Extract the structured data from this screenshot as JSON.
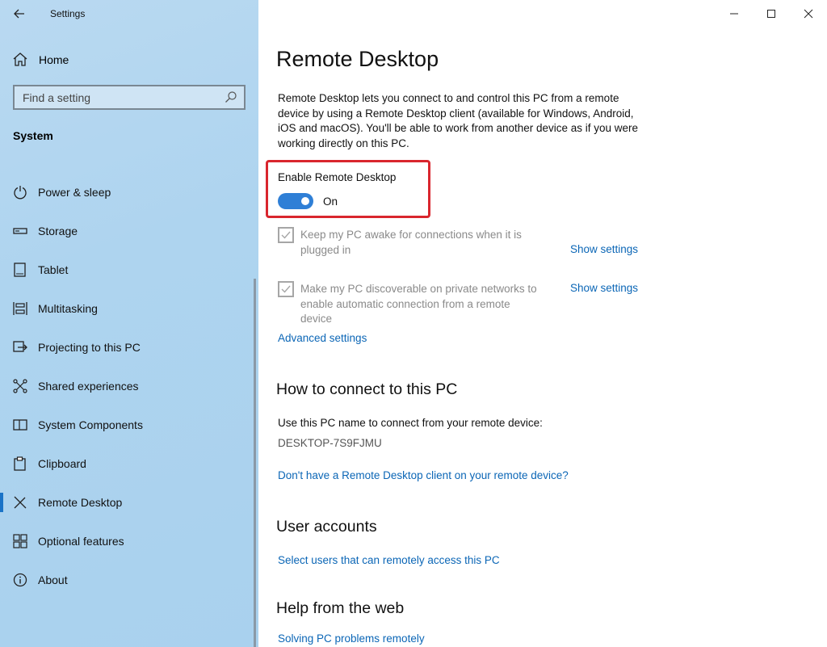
{
  "window": {
    "app_title": "Settings",
    "controls": [
      "minimize-icon",
      "maximize-icon",
      "close-icon"
    ]
  },
  "sidebar": {
    "home_label": "Home",
    "search_placeholder": "Find a setting",
    "section": "System",
    "items": [
      {
        "label": "Power & sleep",
        "icon": "power-icon"
      },
      {
        "label": "Storage",
        "icon": "storage-icon"
      },
      {
        "label": "Tablet",
        "icon": "tablet-icon"
      },
      {
        "label": "Multitasking",
        "icon": "multitasking-icon"
      },
      {
        "label": "Projecting to this PC",
        "icon": "projecting-icon"
      },
      {
        "label": "Shared experiences",
        "icon": "shared-experiences-icon"
      },
      {
        "label": "System Components",
        "icon": "system-components-icon"
      },
      {
        "label": "Clipboard",
        "icon": "clipboard-icon"
      },
      {
        "label": "Remote Desktop",
        "icon": "remote-desktop-icon",
        "active": true
      },
      {
        "label": "Optional features",
        "icon": "optional-features-icon"
      },
      {
        "label": "About",
        "icon": "info-icon"
      }
    ]
  },
  "main": {
    "title": "Remote Desktop",
    "description": "Remote Desktop lets you connect to and control this PC from a remote device by using a Remote Desktop client (available for Windows, Android, iOS and macOS). You'll be able to work from another device as if you were working directly on this PC.",
    "enable_label": "Enable Remote Desktop",
    "toggle_state": "On",
    "option1": "Keep my PC awake for connections when it is plugged in",
    "option2": "Make my PC discoverable on private networks to enable automatic connection from a remote device",
    "show_settings": "Show settings",
    "advanced_settings": "Advanced settings",
    "connect_heading": "How to connect to this PC",
    "connect_text": "Use this PC name to connect from your remote device:",
    "pc_name": "DESKTOP-7S9FJMU",
    "client_link": "Don't have a Remote Desktop client on your remote device?",
    "accounts_heading": "User accounts",
    "accounts_link": "Select users that can remotely access this PC",
    "help_heading": "Help from the web",
    "help_link": "Solving PC problems remotely"
  },
  "colors": {
    "accent": "#2f7fd6",
    "link": "#0b66b6",
    "highlight": "#d9262e",
    "sidebar_bg": "#aed4ef"
  }
}
